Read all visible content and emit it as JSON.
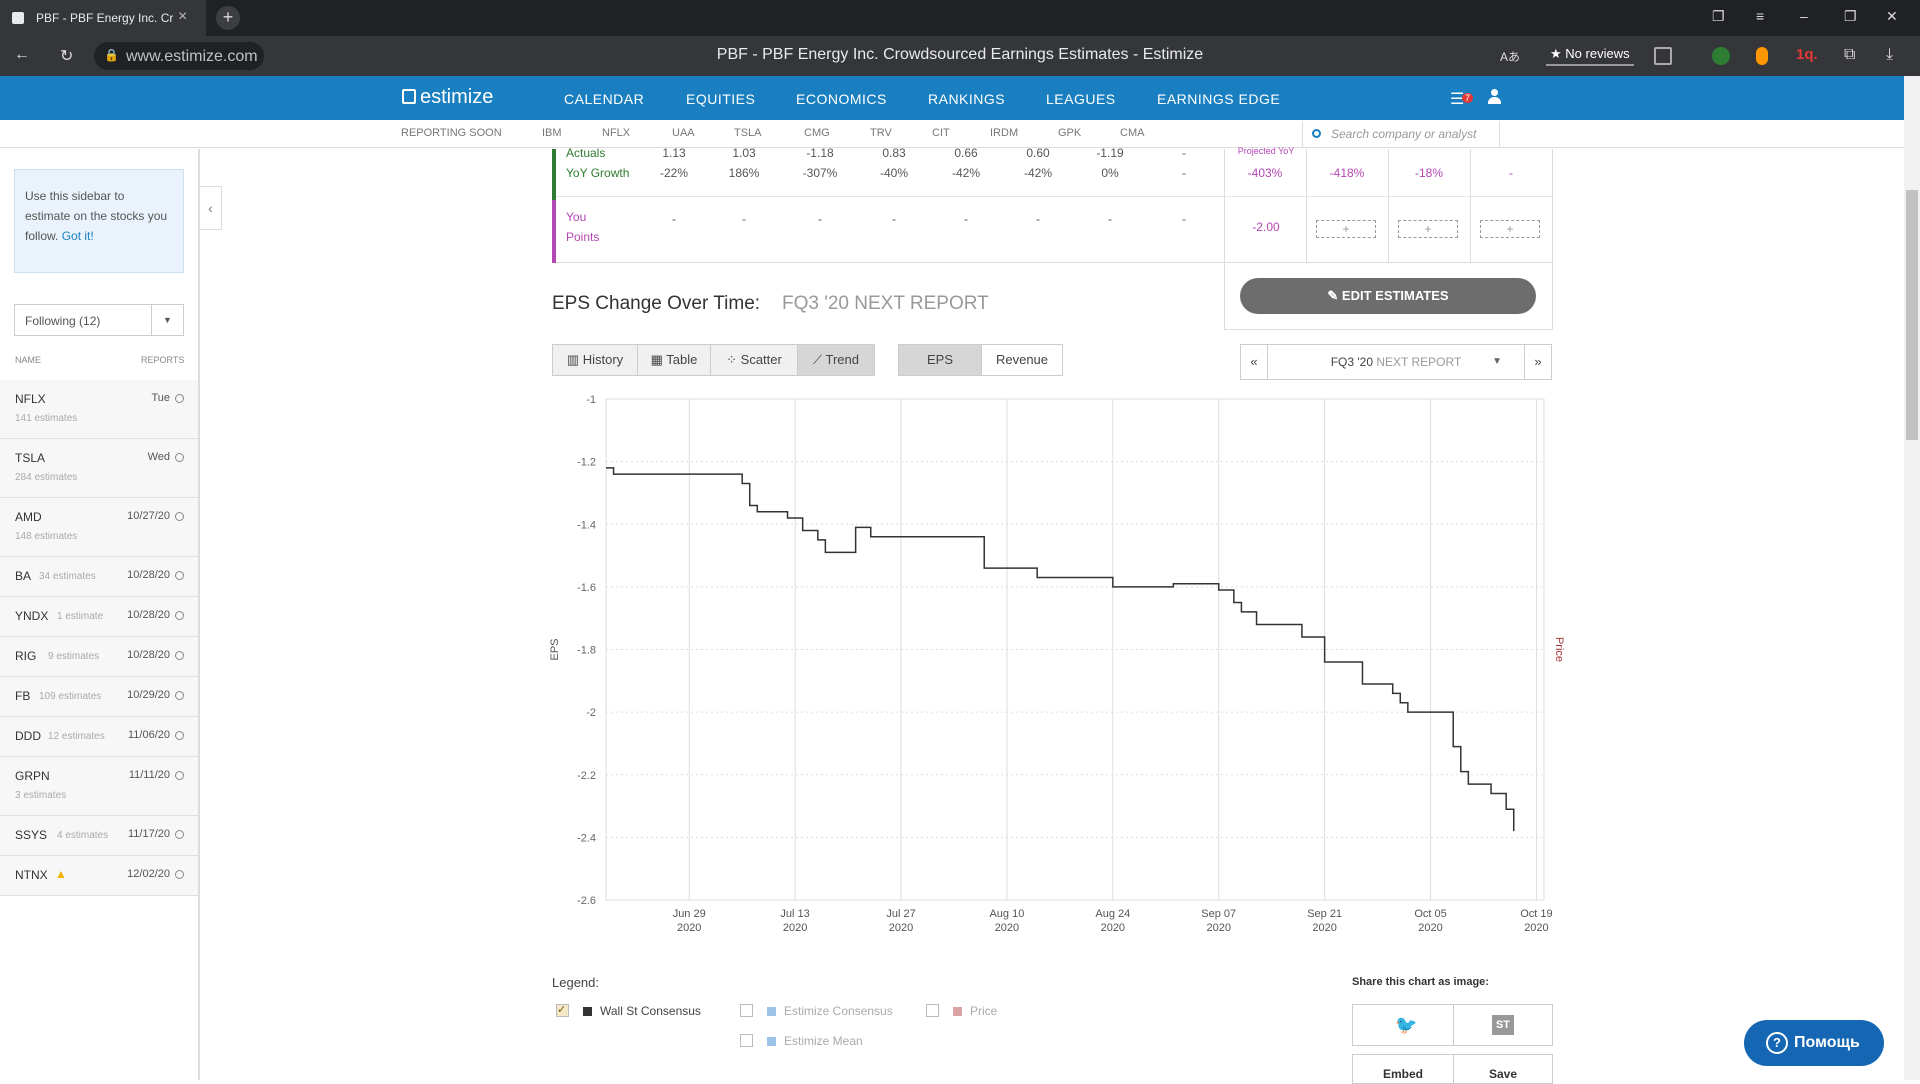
{
  "browser": {
    "tab_title": "PBF - PBF Energy Inc. Cr",
    "url": "www.estimize.com",
    "page_title": "PBF - PBF Energy Inc. Crowdsourced Earnings Estimates - Estimize",
    "reviews_label": "No reviews",
    "ext_badge": "1q."
  },
  "site": {
    "logo": "estimize",
    "nav": [
      "CALENDAR",
      "EQUITIES",
      "ECONOMICS",
      "RANKINGS",
      "LEAGUES",
      "EARNINGS EDGE"
    ],
    "notif_count": "7",
    "reporting_soon": "REPORTING SOON",
    "tickers": [
      "IBM",
      "NFLX",
      "UAA",
      "TSLA",
      "CMG",
      "TRV",
      "CIT",
      "IRDM",
      "GPK",
      "CMA"
    ],
    "search_placeholder": "Search company or analyst"
  },
  "sidebar": {
    "tip_text": "Use this sidebar to estimate on the stocks you follow.",
    "tip_link": "Got it!",
    "following": "Following (12)",
    "col_name": "NAME",
    "col_reports": "REPORTS",
    "rows": [
      {
        "ticker": "NFLX",
        "est": "141 estimates",
        "date": "Tue",
        "two_line": true
      },
      {
        "ticker": "TSLA",
        "est": "284 estimates",
        "date": "Wed",
        "two_line": true
      },
      {
        "ticker": "AMD",
        "est": "148 estimates",
        "date": "10/27/20",
        "two_line": true
      },
      {
        "ticker": "BA",
        "est": "34 estimates",
        "date": "10/28/20",
        "two_line": false
      },
      {
        "ticker": "YNDX",
        "est": "1 estimate",
        "date": "10/28/20",
        "two_line": false
      },
      {
        "ticker": "RIG",
        "est": "9 estimates",
        "date": "10/28/20",
        "two_line": false
      },
      {
        "ticker": "FB",
        "est": "109 estimates",
        "date": "10/29/20",
        "two_line": false
      },
      {
        "ticker": "DDD",
        "est": "12 estimates",
        "date": "11/06/20",
        "two_line": false
      },
      {
        "ticker": "GRPN",
        "est": "3 estimates",
        "date": "11/11/20",
        "two_line": true
      },
      {
        "ticker": "SSYS",
        "est": "4 estimates",
        "date": "11/17/20",
        "two_line": false
      },
      {
        "ticker": "NTNX",
        "est": "",
        "date": "12/02/20",
        "two_line": false
      }
    ]
  },
  "table": {
    "actuals_label": "Actuals",
    "growth_label": "YoY Growth",
    "actuals": [
      "1.13",
      "1.03",
      "-1.18",
      "0.83",
      "0.66",
      "0.60",
      "-1.19",
      "-"
    ],
    "growth": [
      "-22%",
      "186%",
      "-307%",
      "-40%",
      "-42%",
      "-42%",
      "0%",
      "-"
    ],
    "projected_label": "Projected YoY",
    "projected": [
      "-403%",
      "-418%",
      "-18%",
      "-"
    ],
    "you_label": "You",
    "points_label": "Points",
    "you_values": [
      "-",
      "-",
      "-",
      "-",
      "-",
      "-",
      "-",
      "-"
    ],
    "you_estimate": "-2.00"
  },
  "eps_section": {
    "title": "EPS Change Over Time:",
    "subtitle": "FQ3 '20 NEXT REPORT",
    "edit_label": "EDIT ESTIMATES",
    "view_buttons": [
      "History",
      "Table",
      "Scatter",
      "Trend"
    ],
    "metric_buttons": [
      "EPS",
      "Revenue"
    ],
    "quarter": "FQ3 '20",
    "quarter_sub": "NEXT REPORT"
  },
  "chart_data": {
    "type": "line",
    "ylabel": "EPS",
    "y2label": "Price",
    "ylim": [
      -2.6,
      -1
    ],
    "yticks": [
      "-1",
      "-1.2",
      "-1.4",
      "-1.6",
      "-1.8",
      "-2",
      "-2.2",
      "-2.4",
      "-2.6"
    ],
    "xticks": [
      [
        "Jun 29",
        "2020"
      ],
      [
        "Jul 13",
        "2020"
      ],
      [
        "Jul 27",
        "2020"
      ],
      [
        "Aug 10",
        "2020"
      ],
      [
        "Aug 24",
        "2020"
      ],
      [
        "Sep 07",
        "2020"
      ],
      [
        "Sep 21",
        "2020"
      ],
      [
        "Oct 05",
        "2020"
      ],
      [
        "Oct 19",
        "2020"
      ]
    ],
    "series": [
      {
        "name": "Wall St Consensus",
        "color": "#333333",
        "x": [
          "2020-06-18",
          "2020-06-19",
          "2020-07-02",
          "2020-07-06",
          "2020-07-07",
          "2020-07-08",
          "2020-07-09",
          "2020-07-12",
          "2020-07-14",
          "2020-07-16",
          "2020-07-17",
          "2020-07-21",
          "2020-07-21",
          "2020-07-23",
          "2020-07-23",
          "2020-08-06",
          "2020-08-07",
          "2020-08-13",
          "2020-08-14",
          "2020-08-24",
          "2020-08-24",
          "2020-09-01",
          "2020-09-01",
          "2020-09-07",
          "2020-09-09",
          "2020-09-10",
          "2020-09-12",
          "2020-09-17",
          "2020-09-18",
          "2020-09-21",
          "2020-09-21",
          "2020-09-26",
          "2020-09-26",
          "2020-09-30",
          "2020-10-01",
          "2020-10-02",
          "2020-10-05",
          "2020-10-08",
          "2020-10-08",
          "2020-10-09",
          "2020-10-10",
          "2020-10-13",
          "2020-10-13",
          "2020-10-15",
          "2020-10-15",
          "2020-10-16"
        ],
        "y": [
          -1.22,
          -1.24,
          -1.24,
          -1.27,
          -1.34,
          -1.36,
          -1.36,
          -1.38,
          -1.42,
          -1.45,
          -1.49,
          -1.49,
          -1.41,
          -1.41,
          -1.44,
          -1.44,
          -1.54,
          -1.54,
          -1.57,
          -1.57,
          -1.6,
          -1.6,
          -1.59,
          -1.61,
          -1.65,
          -1.68,
          -1.72,
          -1.72,
          -1.76,
          -1.84,
          -1.84,
          -1.91,
          -1.91,
          -1.94,
          -1.97,
          -2.0,
          -2.0,
          -2.02,
          -2.11,
          -2.19,
          -2.23,
          -2.23,
          -2.26,
          -2.26,
          -2.31,
          -2.38
        ]
      }
    ]
  },
  "legend": {
    "title": "Legend:",
    "items": [
      {
        "label": "Wall St Consensus",
        "checked": true,
        "color": "#333333"
      },
      {
        "label": "Estimize Consensus",
        "checked": false,
        "color": "#9dc3e6"
      },
      {
        "label": "Price",
        "checked": false,
        "color": "#d9a3a3"
      },
      {
        "label": "Estimize Mean",
        "checked": false,
        "color": "#9dc3e6"
      }
    ]
  },
  "share": {
    "title": "Share this chart as image:",
    "embed": "Embed",
    "save": "Save",
    "st_icon": "ST"
  },
  "help_label": "Помощь"
}
